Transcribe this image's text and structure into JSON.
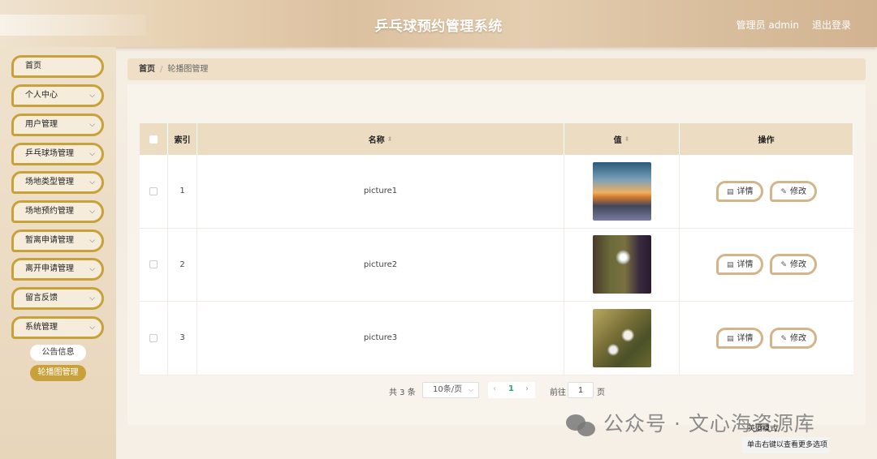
{
  "header": {
    "title": "乒乓球预约管理系统",
    "user": "管理员 admin",
    "logout": "退出登录"
  },
  "sidebar": {
    "items": [
      {
        "label": "首页",
        "has_arrow": false
      },
      {
        "label": "个人中心",
        "has_arrow": true
      },
      {
        "label": "用户管理",
        "has_arrow": true
      },
      {
        "label": "乒乓球场管理",
        "has_arrow": true
      },
      {
        "label": "场地类型管理",
        "has_arrow": true
      },
      {
        "label": "场地预约管理",
        "has_arrow": true
      },
      {
        "label": "暂离申请管理",
        "has_arrow": true
      },
      {
        "label": "离开申请管理",
        "has_arrow": true
      },
      {
        "label": "留言反馈",
        "has_arrow": true
      },
      {
        "label": "系统管理",
        "has_arrow": true
      }
    ],
    "sub_items": [
      {
        "label": "公告信息",
        "active": false
      },
      {
        "label": "轮播图管理",
        "active": true
      }
    ],
    "arrow_icon": "chevron-down-icon"
  },
  "breadcrumb": {
    "home": "首页",
    "separator": "/",
    "current": "轮播图管理"
  },
  "table": {
    "columns": {
      "index": "索引",
      "name": "名称",
      "value": "值",
      "actions": "操作"
    },
    "rows": [
      {
        "index": "1",
        "name": "picture1",
        "image": "sunset-road-image"
      },
      {
        "index": "2",
        "name": "picture2",
        "image": "white-flower-image"
      },
      {
        "index": "3",
        "name": "picture3",
        "image": "daisies-image"
      }
    ],
    "detail_label": "详情",
    "edit_label": "修改"
  },
  "pagination": {
    "total": "共 3 条",
    "page_size": "10条/页",
    "current_page": "1",
    "goto_label": "前往",
    "goto_value": "1",
    "page_suffix": "页"
  },
  "watermark": "公众号 · 文心海资源库",
  "context_menu": {
    "item1": "英酒模式",
    "item2": "单击右键以查看更多选项"
  },
  "colors": {
    "accent_gold": "#c9a13a",
    "header_bg": "#dcc1a0",
    "table_head_bg": "#ecdcc2",
    "active_page": "#2aa37a"
  }
}
